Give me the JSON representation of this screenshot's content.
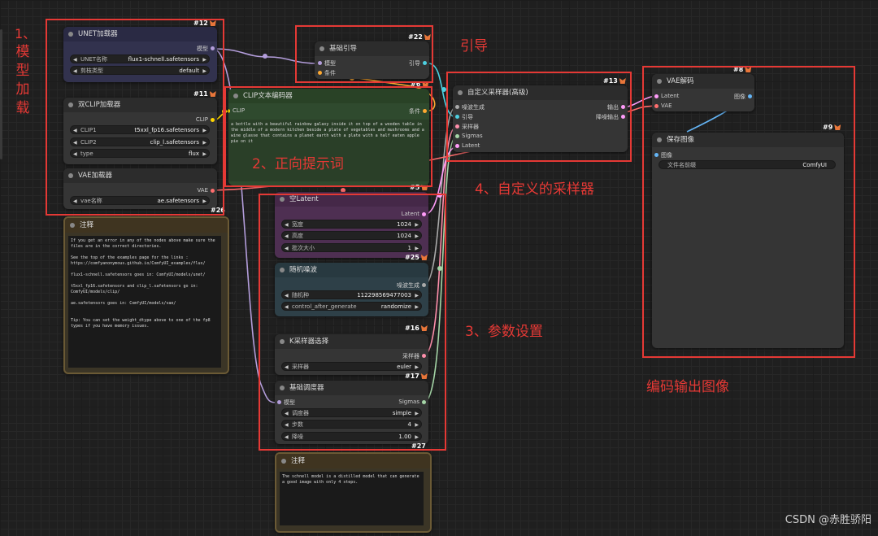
{
  "nodes": {
    "unet": {
      "id": "#12",
      "title": "UNET加载器",
      "out_model": "模型",
      "w1_label": "UNET名称",
      "w1_value": "flux1-schnell.safetensors",
      "w2_label": "剪枝类型",
      "w2_value": "default"
    },
    "dualclip": {
      "id": "#11",
      "title": "双CLIP加载器",
      "out_clip": "CLIP",
      "w1_label": "CLIP1",
      "w1_value": "t5xxl_fp16.safetensors",
      "w2_label": "CLIP2",
      "w2_value": "clip_l.safetensors",
      "w3_label": "type",
      "w3_value": "flux"
    },
    "vae_loader": {
      "id": "#26",
      "title": "VAE加载器",
      "out_vae": "VAE",
      "w1_label": "vae名称",
      "w1_value": "ae.safetensors"
    },
    "note1": {
      "title": "注释",
      "text": "If you get an error in any of the nodes above make sure the files are in the correct directories.\n\nSee the top of the examples page for the links :\nhttps://comfyanonymous.github.io/ComfyUI_examples/flux/\n\nflux1-schnell.safetensors goes in: ComfyUI/models/unet/\n\nt5xxl_fp16.safetensors and clip_l.safetensors go in:\nComfyUI/models/clip/\n\nae.safetensors goes in: ComfyUI/models/vae/\n\n\nTip: You can set the weight_dtype above to one of the fp8 types if you have memory issues."
    },
    "guide": {
      "id": "#22",
      "title": "基础引导",
      "in_model": "模型",
      "in_cond": "条件",
      "out_guide": "引导"
    },
    "clip_encode": {
      "id": "#6",
      "id2": "#5",
      "title": "CLIP文本编码器",
      "in_clip": "CLIP",
      "out_cond": "条件",
      "text": "a bottle with a beautiful rainbow galaxy inside it on top of a wooden table in the middle of a modern kitchen beside a plate of vegetables and mushrooms and a wine glasse that contains a planet earth with a plate with a half eaten apple pie on it"
    },
    "custom_sampler": {
      "id": "#13",
      "title": "自定义采样器(高级)",
      "in1": "噪波生成",
      "in2": "引导",
      "in3": "采样器",
      "in4": "Sigmas",
      "in5": "Latent",
      "out1": "输出",
      "out2": "降噪输出"
    },
    "empty_latent": {
      "id": "#25",
      "title": "空Latent",
      "out_latent": "Latent",
      "w1_label": "宽度",
      "w1_value": "1024",
      "w2_label": "高度",
      "w2_value": "1024",
      "w3_label": "批次大小",
      "w3_value": "1"
    },
    "random_noise": {
      "id": "#16",
      "title": "随机噪波",
      "out_noise": "噪波生成",
      "w1_label": "随机种",
      "w1_value": "112298569477003",
      "w2_label": "control_after_generate",
      "w2_value": "randomize"
    },
    "ksampler_select": {
      "id": "#17",
      "title": "K采样器选择",
      "out_sampler": "采样器",
      "w1_label": "采样器",
      "w1_value": "euler"
    },
    "basic_scheduler": {
      "id": "#27",
      "title": "基础调度器",
      "in_model": "模型",
      "out_sigmas": "Sigmas",
      "w1_label": "调度器",
      "w1_value": "simple",
      "w2_label": "步数",
      "w2_value": "4",
      "w3_label": "降噪",
      "w3_value": "1.00"
    },
    "note2": {
      "title": "注释",
      "text": "The schnell model is a distilled model that can generate a good image with only 4 steps."
    },
    "vae_decode": {
      "id": "#8",
      "title": "VAE解码",
      "in_latent": "Latent",
      "in_vae": "VAE",
      "out_image": "图像"
    },
    "save_image": {
      "id": "#9",
      "title": "保存图像",
      "in_image": "图像",
      "w1_label": "文件名前缀",
      "w1_value": "ComfyUI"
    }
  },
  "annotations": {
    "a1": [
      "1、",
      "模",
      "型",
      "加",
      "载"
    ],
    "a_guide": "引导",
    "a2": "2、正向提示词",
    "a3": "3、参数设置",
    "a4": "4、自定义的采样器",
    "a5": "编码输出图像"
  },
  "watermark": "CSDN @赤胜骄阳",
  "colors": {
    "annotation_red": "#e53935",
    "model_wire": "#b39ddb",
    "clip_wire": "#ffd500",
    "vae_wire": "#ff6e6e",
    "latent_wire": "#ff9cf9",
    "image_wire": "#64b5f6",
    "cond_wire": "#ffa931"
  }
}
